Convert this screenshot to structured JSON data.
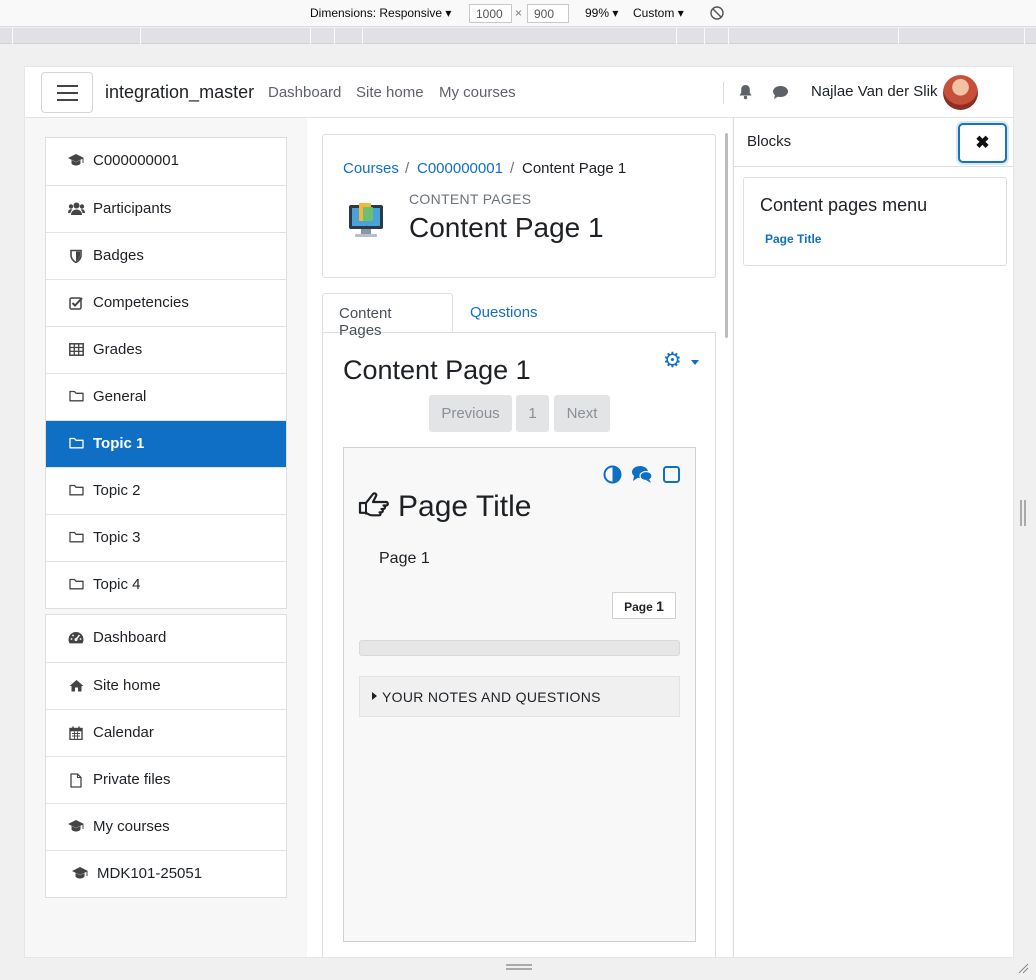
{
  "devtools": {
    "dimensions_label": "Dimensions: Responsive",
    "width": "1000",
    "times": "×",
    "height": "900",
    "zoom": "99%",
    "throttle": "Custom"
  },
  "navbar": {
    "site_name": "integration_master",
    "links": [
      "Dashboard",
      "Site home",
      "My courses"
    ],
    "user_name": "Najlae Van der Slik"
  },
  "drawer": {
    "course_items": [
      {
        "label": "C000000001",
        "icon": "graduation-cap-icon"
      },
      {
        "label": "Participants",
        "icon": "users-icon"
      },
      {
        "label": "Badges",
        "icon": "shield-icon"
      },
      {
        "label": "Competencies",
        "icon": "check-square-icon"
      },
      {
        "label": "Grades",
        "icon": "table-icon"
      },
      {
        "label": "General",
        "icon": "folder-icon"
      },
      {
        "label": "Topic 1",
        "icon": "folder-icon",
        "active": true
      },
      {
        "label": "Topic 2",
        "icon": "folder-icon"
      },
      {
        "label": "Topic 3",
        "icon": "folder-icon"
      },
      {
        "label": "Topic 4",
        "icon": "folder-icon"
      }
    ],
    "site_items": [
      {
        "label": "Dashboard",
        "icon": "tachometer-icon"
      },
      {
        "label": "Site home",
        "icon": "home-icon"
      },
      {
        "label": "Calendar",
        "icon": "calendar-icon"
      },
      {
        "label": "Private files",
        "icon": "file-icon"
      },
      {
        "label": "My courses",
        "icon": "graduation-cap-icon"
      }
    ],
    "course_list_item": {
      "label": "MDK101-25051",
      "icon": "graduation-cap-icon"
    }
  },
  "breadcrumb": {
    "items": [
      "Courses",
      "C000000001",
      "Content Page 1"
    ],
    "separator": "/"
  },
  "header": {
    "module_type": "CONTENT PAGES",
    "title": "Content Page 1"
  },
  "tabs": [
    "Content Pages",
    "Questions"
  ],
  "content": {
    "title": "Content Page 1",
    "pagination": {
      "previous": "Previous",
      "page": "1",
      "next": "Next"
    },
    "page_card": {
      "title": "Page Title",
      "body": "Page 1",
      "badge_prefix": "Page",
      "badge_number": "1",
      "notes_label": "YOUR NOTES AND QUESTIONS",
      "progress": 0
    }
  },
  "blocks": {
    "title": "Blocks",
    "close_glyph": "✖",
    "menu_title": "Content pages menu",
    "menu_link": "Page Title"
  },
  "colors": {
    "accent": "#0f6fc5",
    "active_bg": "#0f6fc5"
  }
}
